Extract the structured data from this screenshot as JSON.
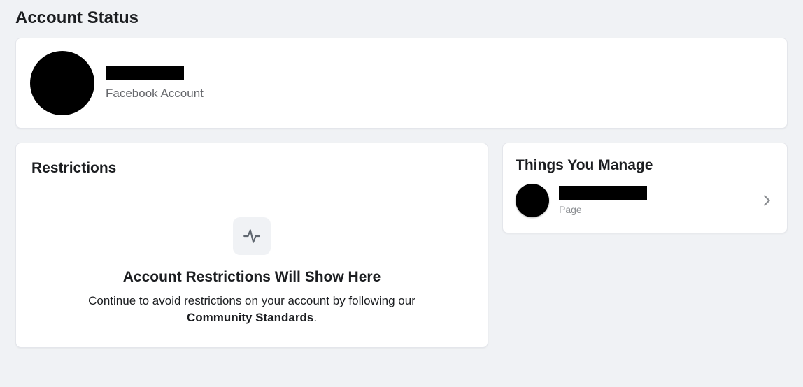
{
  "page": {
    "title": "Account Status"
  },
  "account": {
    "subtitle": "Facebook Account"
  },
  "restrictions": {
    "title": "Restrictions",
    "heading": "Account Restrictions Will Show Here",
    "body_prefix": "Continue to avoid restrictions on your account by following our ",
    "body_bold": "Community Standards",
    "body_suffix": "."
  },
  "manage": {
    "title": "Things You Manage",
    "items": [
      {
        "type": "Page"
      }
    ]
  }
}
